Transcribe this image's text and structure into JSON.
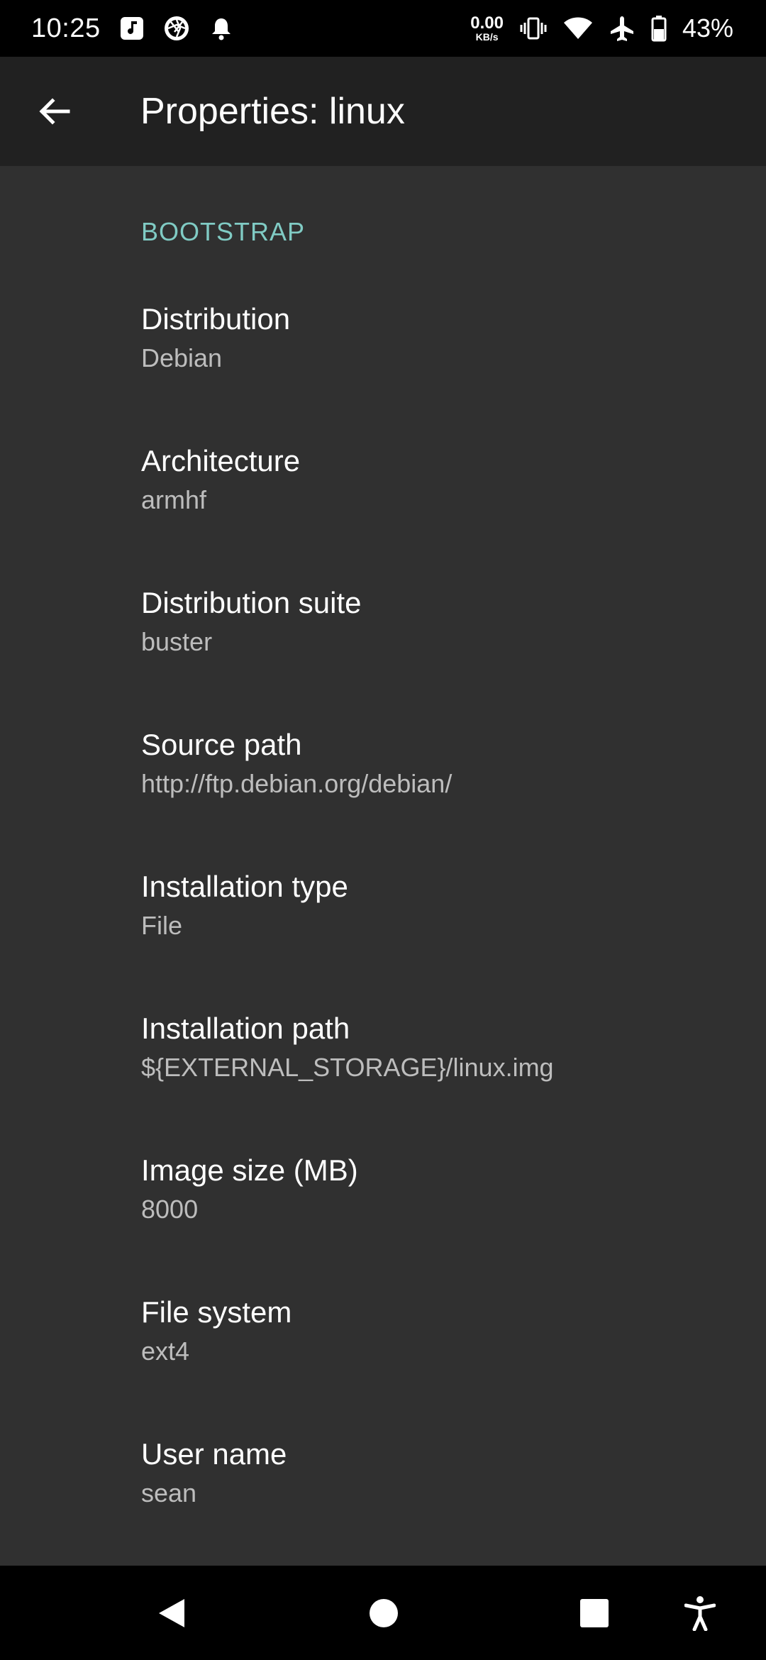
{
  "status_bar": {
    "time": "10:25",
    "net_speed_value": "0.00",
    "net_speed_unit": "KB/s",
    "battery_percent": "43%",
    "left_icons": [
      "music-note-icon",
      "aperture-icon",
      "notification-bell-icon"
    ],
    "right_icons": [
      "vibrate-icon",
      "wifi-icon",
      "airplane-icon",
      "battery-icon"
    ]
  },
  "app_bar": {
    "title": "Properties: linux",
    "back_icon": "arrow-back-icon"
  },
  "section": {
    "header": "BOOTSTRAP"
  },
  "preferences": [
    {
      "title": "Distribution",
      "summary": "Debian"
    },
    {
      "title": "Architecture",
      "summary": "armhf"
    },
    {
      "title": "Distribution suite",
      "summary": "buster"
    },
    {
      "title": "Source path",
      "summary": "http://ftp.debian.org/debian/"
    },
    {
      "title": "Installation type",
      "summary": "File"
    },
    {
      "title": "Installation path",
      "summary": "${EXTERNAL_STORAGE}/linux.img"
    },
    {
      "title": "Image size (MB)",
      "summary": "8000"
    },
    {
      "title": "File system",
      "summary": "ext4"
    },
    {
      "title": "User name",
      "summary": "sean"
    }
  ],
  "nav_bar": {
    "icons": [
      "back-triangle-icon",
      "home-circle-icon",
      "recents-square-icon",
      "accessibility-icon"
    ]
  },
  "colors": {
    "accent": "#80cbc4",
    "background": "#303030",
    "app_bar": "#212121"
  }
}
